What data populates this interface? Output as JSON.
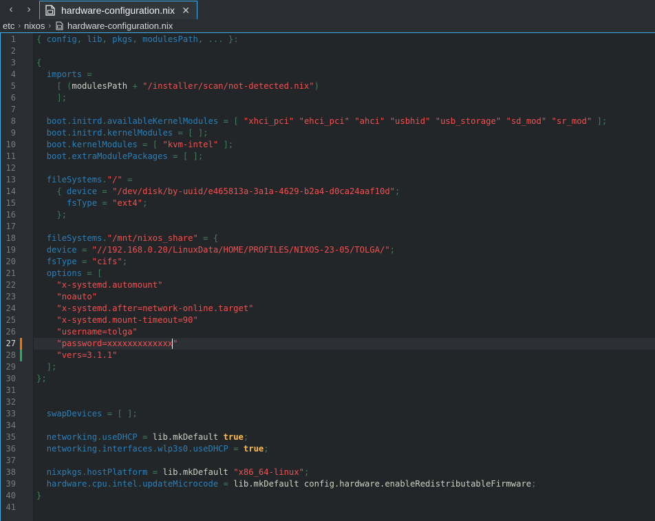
{
  "tab": {
    "title": "hardware-configuration.nix",
    "close": "✕"
  },
  "nav": {
    "back": "‹",
    "forward": "›"
  },
  "breadcrumb": {
    "items": [
      "etc",
      "nixos",
      "hardware-configuration.nix"
    ],
    "separator": "›"
  },
  "editor": {
    "current_line": 27,
    "modified_lines": [
      {
        "line": 27,
        "color": "#f67400"
      },
      {
        "line": 28,
        "color": "#27ae60"
      }
    ],
    "lines": [
      [
        [
          "op",
          "{ "
        ],
        [
          "key",
          "config"
        ],
        [
          "op",
          ", "
        ],
        [
          "key",
          "lib"
        ],
        [
          "op",
          ", "
        ],
        [
          "key",
          "pkgs"
        ],
        [
          "op",
          ", "
        ],
        [
          "key",
          "modulesPath"
        ],
        [
          "op",
          ", ... }:"
        ]
      ],
      [],
      [
        [
          "op",
          "{"
        ]
      ],
      [
        [
          "txt",
          "  "
        ],
        [
          "key",
          "imports"
        ],
        [
          "op",
          " ="
        ]
      ],
      [
        [
          "txt",
          "    "
        ],
        [
          "op",
          "[ ("
        ],
        [
          "txt",
          "modulesPath "
        ],
        [
          "op",
          "+ "
        ],
        [
          "str",
          "\"/installer/scan/not-detected.nix\""
        ],
        [
          "op",
          ")"
        ]
      ],
      [
        [
          "txt",
          "    "
        ],
        [
          "op",
          "];"
        ]
      ],
      [],
      [
        [
          "txt",
          "  "
        ],
        [
          "key",
          "boot"
        ],
        [
          "op",
          "."
        ],
        [
          "key",
          "initrd"
        ],
        [
          "op",
          "."
        ],
        [
          "key",
          "availableKernelModules"
        ],
        [
          "op",
          " = [ "
        ],
        [
          "str",
          "\"xhci_pci\""
        ],
        [
          "txt",
          " "
        ],
        [
          "str",
          "\"ehci_pci\""
        ],
        [
          "txt",
          " "
        ],
        [
          "str",
          "\"ahci\""
        ],
        [
          "txt",
          " "
        ],
        [
          "str",
          "\"usbhid\""
        ],
        [
          "txt",
          " "
        ],
        [
          "str",
          "\"usb_storage\""
        ],
        [
          "txt",
          " "
        ],
        [
          "str",
          "\"sd_mod\""
        ],
        [
          "txt",
          " "
        ],
        [
          "str",
          "\"sr_mod\""
        ],
        [
          "op",
          " ];"
        ]
      ],
      [
        [
          "txt",
          "  "
        ],
        [
          "key",
          "boot"
        ],
        [
          "op",
          "."
        ],
        [
          "key",
          "initrd"
        ],
        [
          "op",
          "."
        ],
        [
          "key",
          "kernelModules"
        ],
        [
          "op",
          " = [ ];"
        ]
      ],
      [
        [
          "txt",
          "  "
        ],
        [
          "key",
          "boot"
        ],
        [
          "op",
          "."
        ],
        [
          "key",
          "kernelModules"
        ],
        [
          "op",
          " = [ "
        ],
        [
          "str",
          "\"kvm-intel\""
        ],
        [
          "op",
          " ];"
        ]
      ],
      [
        [
          "txt",
          "  "
        ],
        [
          "key",
          "boot"
        ],
        [
          "op",
          "."
        ],
        [
          "key",
          "extraModulePackages"
        ],
        [
          "op",
          " = [ ];"
        ]
      ],
      [],
      [
        [
          "txt",
          "  "
        ],
        [
          "key",
          "fileSystems"
        ],
        [
          "op",
          "."
        ],
        [
          "str",
          "\"/\""
        ],
        [
          "op",
          " ="
        ]
      ],
      [
        [
          "txt",
          "    "
        ],
        [
          "op",
          "{ "
        ],
        [
          "key",
          "device"
        ],
        [
          "op",
          " = "
        ],
        [
          "str",
          "\"/dev/disk/by-uuid/e465813a-3a1a-4629-b2a4-d0ca24aaf10d\""
        ],
        [
          "op",
          ";"
        ]
      ],
      [
        [
          "txt",
          "      "
        ],
        [
          "key",
          "fsType"
        ],
        [
          "op",
          " = "
        ],
        [
          "str",
          "\"ext4\""
        ],
        [
          "op",
          ";"
        ]
      ],
      [
        [
          "txt",
          "    "
        ],
        [
          "op",
          "};"
        ]
      ],
      [],
      [
        [
          "txt",
          "  "
        ],
        [
          "key",
          "fileSystems"
        ],
        [
          "op",
          "."
        ],
        [
          "str",
          "\"/mnt/nixos_share\""
        ],
        [
          "op",
          " = {"
        ]
      ],
      [
        [
          "txt",
          "  "
        ],
        [
          "key",
          "device"
        ],
        [
          "op",
          " = "
        ],
        [
          "str",
          "\"//192.168.0.20/LinuxData/HOME/PROFILES/NIXOS-23-05/TOLGA/\""
        ],
        [
          "op",
          ";"
        ]
      ],
      [
        [
          "txt",
          "  "
        ],
        [
          "key",
          "fsType"
        ],
        [
          "op",
          " = "
        ],
        [
          "str",
          "\"cifs\""
        ],
        [
          "op",
          ";"
        ]
      ],
      [
        [
          "txt",
          "  "
        ],
        [
          "key",
          "options"
        ],
        [
          "op",
          " = ["
        ]
      ],
      [
        [
          "txt",
          "    "
        ],
        [
          "str",
          "\"x-systemd.automount\""
        ]
      ],
      [
        [
          "txt",
          "    "
        ],
        [
          "str",
          "\"noauto\""
        ]
      ],
      [
        [
          "txt",
          "    "
        ],
        [
          "str",
          "\"x-systemd.after=network-online.target\""
        ]
      ],
      [
        [
          "txt",
          "    "
        ],
        [
          "str",
          "\"x-systemd.mount-timeout=90\""
        ]
      ],
      [
        [
          "txt",
          "    "
        ],
        [
          "str",
          "\"username=tolga\""
        ]
      ],
      [
        [
          "txt",
          "    "
        ],
        [
          "str",
          "\"password=xxxxxxxxxxxxx"
        ],
        [
          "cursor",
          ""
        ],
        [
          "str",
          "\""
        ]
      ],
      [
        [
          "txt",
          "    "
        ],
        [
          "str",
          "\"vers=3.1.1\""
        ]
      ],
      [
        [
          "txt",
          "  "
        ],
        [
          "op",
          "];"
        ]
      ],
      [
        [
          "op",
          "};"
        ]
      ],
      [],
      [],
      [
        [
          "txt",
          "  "
        ],
        [
          "key",
          "swapDevices"
        ],
        [
          "op",
          " = [ ];"
        ]
      ],
      [],
      [
        [
          "txt",
          "  "
        ],
        [
          "key",
          "networking"
        ],
        [
          "op",
          "."
        ],
        [
          "key",
          "useDHCP"
        ],
        [
          "op",
          " = "
        ],
        [
          "txt",
          "lib.mkDefault "
        ],
        [
          "bool",
          "true"
        ],
        [
          "op",
          ";"
        ]
      ],
      [
        [
          "txt",
          "  "
        ],
        [
          "key",
          "networking"
        ],
        [
          "op",
          "."
        ],
        [
          "key",
          "interfaces"
        ],
        [
          "op",
          "."
        ],
        [
          "key",
          "wlp3s0"
        ],
        [
          "op",
          "."
        ],
        [
          "key",
          "useDHCP"
        ],
        [
          "op",
          " = "
        ],
        [
          "bool",
          "true"
        ],
        [
          "op",
          ";"
        ]
      ],
      [],
      [
        [
          "txt",
          "  "
        ],
        [
          "key",
          "nixpkgs"
        ],
        [
          "op",
          "."
        ],
        [
          "key",
          "hostPlatform"
        ],
        [
          "op",
          " = "
        ],
        [
          "txt",
          "lib.mkDefault "
        ],
        [
          "str",
          "\"x86_64-linux\""
        ],
        [
          "op",
          ";"
        ]
      ],
      [
        [
          "txt",
          "  "
        ],
        [
          "key",
          "hardware"
        ],
        [
          "op",
          "."
        ],
        [
          "key",
          "cpu"
        ],
        [
          "op",
          "."
        ],
        [
          "key",
          "intel"
        ],
        [
          "op",
          "."
        ],
        [
          "key",
          "updateMicrocode"
        ],
        [
          "op",
          " = "
        ],
        [
          "txt",
          "lib.mkDefault config.hardware.enableRedistributableFirmware"
        ],
        [
          "op",
          ";"
        ]
      ],
      [
        [
          "op",
          "}"
        ]
      ],
      []
    ]
  }
}
